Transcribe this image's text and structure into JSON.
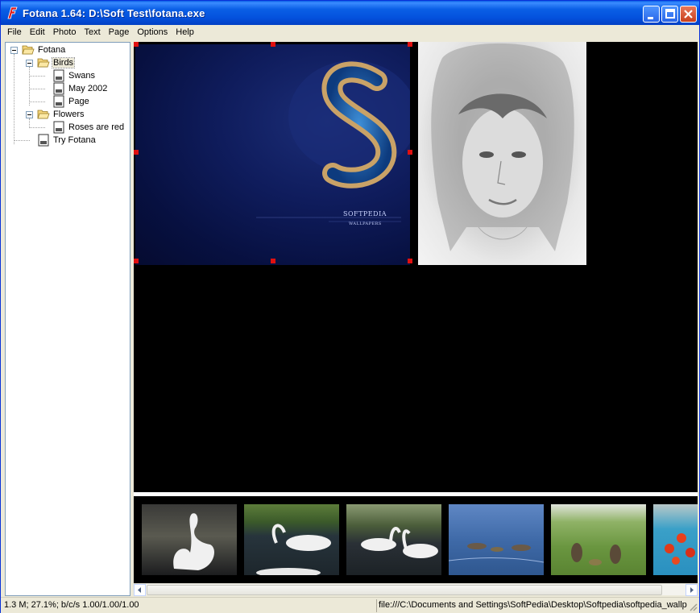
{
  "window": {
    "title": "Fotana 1.64: D:\\Soft Test\\fotana.exe",
    "icon": "fotana-app-icon"
  },
  "menu": [
    "File",
    "Edit",
    "Photo",
    "Text",
    "Page",
    "Options",
    "Help"
  ],
  "tree": {
    "root": "Fotana",
    "birds": "Birds",
    "swans": "Swans",
    "may2002": "May 2002",
    "page": "Page",
    "flowers": "Flowers",
    "roses": "Roses are red",
    "try": "Try Fotana"
  },
  "canvas": {
    "photo1_caption": "SOFTPEDIA",
    "photo1_subcaption": "WALLPAPERS"
  },
  "thumbnails": [
    "swan-single",
    "swans-grass",
    "swans-pair",
    "geese-water",
    "geese-lawn",
    "tulips-pool"
  ],
  "status": {
    "left": "1.3 M; 27.1%; b/c/s 1.00/1.00/1.00",
    "right": "file:///C:\\Documents and Settings\\SoftPedia\\Desktop\\Softpedia\\softpedia_wallpa"
  },
  "colors": {
    "titlebar": "#0a5fe6",
    "selection_handle": "#e01010",
    "canvas_bg": "#000000"
  }
}
